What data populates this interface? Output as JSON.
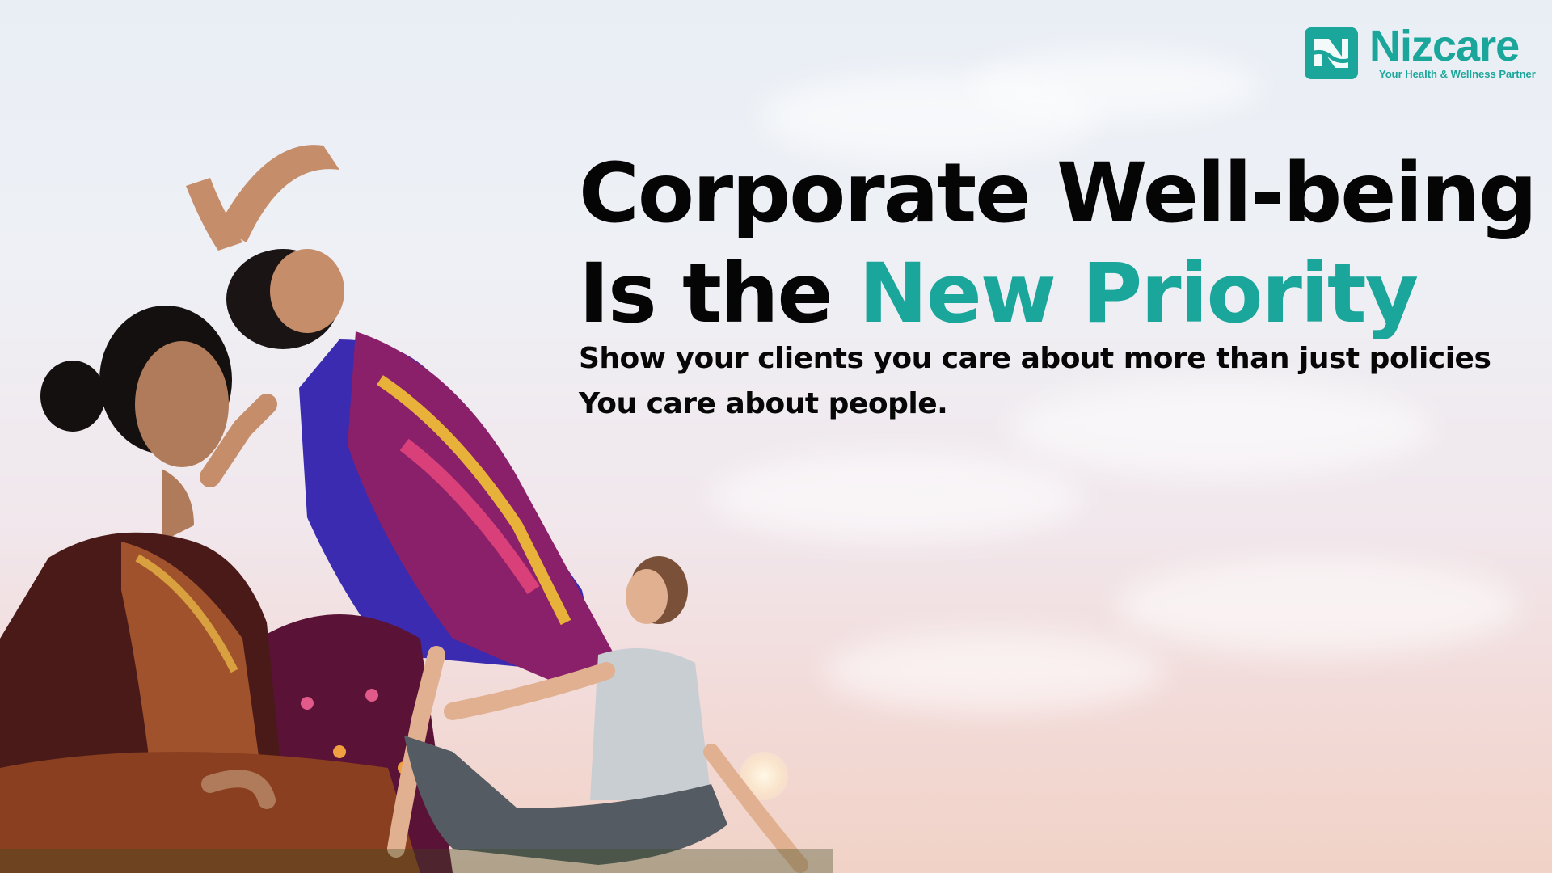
{
  "brand": {
    "name": "Nizcare",
    "tagline": "Your Health & Wellness Partner",
    "accent_color": "#1aa69a",
    "logo_icon": "nizcare-mark-icon"
  },
  "headline": {
    "line1": "Corporate Well-being",
    "line2_prefix": "Is the ",
    "line2_accent": "New Priority"
  },
  "subheading": {
    "line1": "Show your clients you care about more than just policies",
    "line2": "You care about people."
  },
  "image": {
    "description_icon": "yoga-women-photo-icon"
  }
}
